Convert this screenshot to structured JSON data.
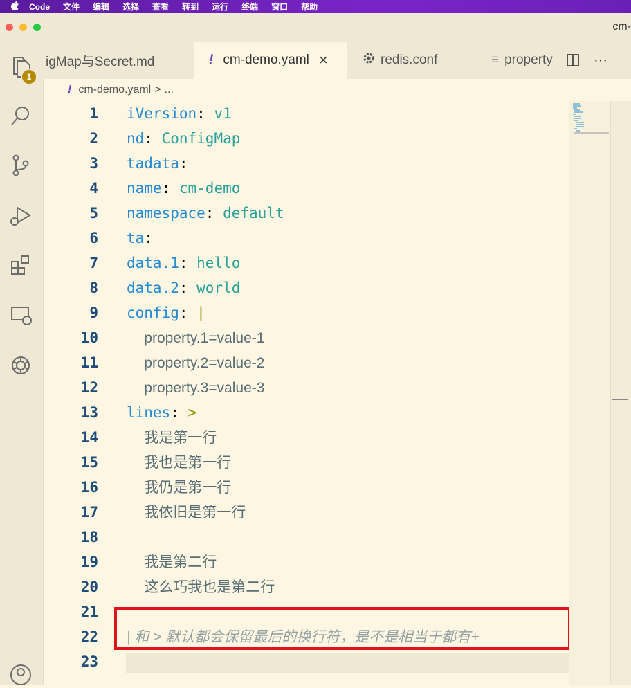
{
  "menubar": {
    "app": "Code",
    "items": [
      "文件",
      "编辑",
      "选择",
      "查看",
      "转到",
      "运行",
      "终端",
      "窗口",
      "帮助"
    ]
  },
  "window": {
    "title": "cm-"
  },
  "activity": {
    "badge": "1"
  },
  "tabs": [
    {
      "label": "igMap与Secret.md",
      "icon": "",
      "active": false
    },
    {
      "label": "cm-demo.yaml",
      "icon": "!",
      "active": true,
      "close": "×"
    },
    {
      "label": "redis.conf",
      "icon": "gear-icon",
      "active": false
    },
    {
      "label": "property",
      "icon": "≡",
      "active": false
    }
  ],
  "tab_actions": {
    "more": "···"
  },
  "breadcrumb": {
    "icon": "!",
    "file": "cm-demo.yaml",
    "sep": ">",
    "rest": "..."
  },
  "lines": [
    {
      "n": "1",
      "key": "iVersion",
      "sep": ": ",
      "val": "v1"
    },
    {
      "n": "2",
      "key": "nd",
      "sep": ": ",
      "val": "ConfigMap"
    },
    {
      "n": "3",
      "key": "tadata",
      "sep": ":",
      "val": ""
    },
    {
      "n": "4",
      "key": "name",
      "sep": ": ",
      "val": "cm-demo"
    },
    {
      "n": "5",
      "key": "namespace",
      "sep": ": ",
      "val": "default"
    },
    {
      "n": "6",
      "key": "ta",
      "sep": ":",
      "val": ""
    },
    {
      "n": "7",
      "key": "data.1",
      "sep": ": ",
      "val": "hello"
    },
    {
      "n": "8",
      "key": "data.2",
      "sep": ": ",
      "val": "world"
    },
    {
      "n": "9",
      "key": "config",
      "sep": ": ",
      "op": "|"
    },
    {
      "n": "10",
      "indent": "  ",
      "str": "property.1=value-1"
    },
    {
      "n": "11",
      "indent": "  ",
      "str": "property.2=value-2"
    },
    {
      "n": "12",
      "indent": "  ",
      "str": "property.3=value-3"
    },
    {
      "n": "13",
      "key": "lines",
      "sep": ": ",
      "op": ">"
    },
    {
      "n": "14",
      "indent": "  ",
      "str": "我是第一行"
    },
    {
      "n": "15",
      "indent": "  ",
      "str": "我也是第一行"
    },
    {
      "n": "16",
      "indent": "  ",
      "str": "我仍是第一行"
    },
    {
      "n": "17",
      "indent": "  ",
      "str": "我依旧是第一行"
    },
    {
      "n": "18",
      "str": ""
    },
    {
      "n": "19",
      "indent": "  ",
      "str": "我是第二行"
    },
    {
      "n": "20",
      "indent": "  ",
      "str": "这么巧我也是第二行"
    },
    {
      "n": "21",
      "str": ""
    },
    {
      "n": "22",
      "comment": "| 和 > 默认都会保留最后的换行符，是不是相当于都有+"
    },
    {
      "n": "23",
      "str": ""
    }
  ],
  "colors": {
    "accent": "#7a24c8",
    "highlight_box": "#e0121c",
    "background": "#fdf6e3"
  }
}
